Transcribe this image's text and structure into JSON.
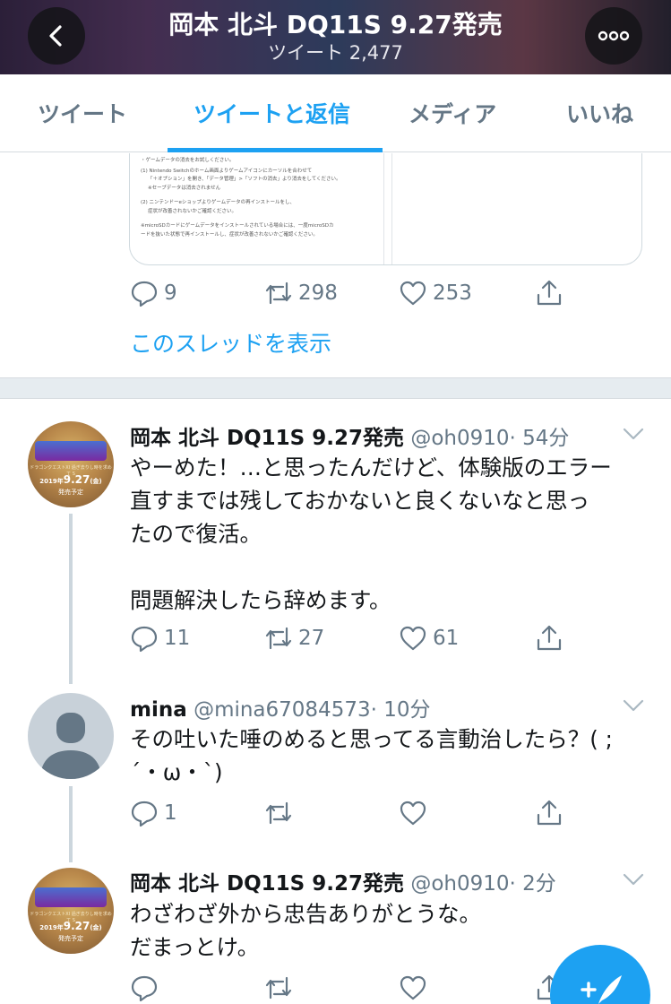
{
  "header": {
    "title": "岡本 北斗 DQ11S 9.27発売",
    "subtitle": "ツイート 2,477"
  },
  "tabs": [
    {
      "label": "ツイート",
      "active": false
    },
    {
      "label": "ツイートと返信",
      "active": true
    },
    {
      "label": "メディア",
      "active": false
    },
    {
      "label": "いいね",
      "active": false
    }
  ],
  "image_card": {
    "lines": [
      "・ゲームデータの消去をお試しください。",
      "(1) Nintendo Switchのホーム画面よりゲームアイコンにカーソルを合わせて",
      "「＋オプション」を開き、「データ管理」>「ソフトの消去」より消去をしてください。",
      "※セーブデータは消去されません",
      "(2) ニンテンドーeショップよりゲームデータの再インストールをし、",
      "症状が改善されないかご確認ください。",
      "※microSDカードにゲームデータをインストールされている場合には、一度microSDカ",
      "ードを抜いた状態で再インストールし、症状が改善されないかご確認ください。"
    ]
  },
  "first_actions": {
    "reply": "9",
    "retweet": "298",
    "like": "253"
  },
  "show_thread": "このスレッドを表示",
  "tweets": [
    {
      "name": "岡本 北斗 DQ11S 9.27発売",
      "handle": "@oh0910",
      "time": "· 54分",
      "text": "やーめた！…と思ったんだけど、体験版のエラー\n直すまでは残しておかないと良くないなと思っ\nたので復活。\n\n問題解決したら辞めます。",
      "reply": "11",
      "retweet": "27",
      "like": "61"
    },
    {
      "name": "mina",
      "handle": "@mina67084573",
      "time": "· 10分",
      "text": "その吐いた唾のめると思ってる言動治したら？( ;\n´・ω・`)",
      "reply": "1",
      "retweet": "",
      "like": ""
    },
    {
      "name": "岡本 北斗 DQ11S 9.27発売",
      "handle": "@oh0910",
      "time": "· 2分",
      "text": "わざわざ外から忠告ありがとうな。\nだまっとけ。",
      "reply": "",
      "retweet": "",
      "like": ""
    }
  ],
  "avatar_badge": {
    "top_text": "ドラゴンクエストXI 過ぎ去りし時を求めて S",
    "year": "2019年",
    "date": "9.27",
    "weekday": "(金)",
    "release": "発売予定"
  },
  "colors": {
    "accent": "#1da1f2",
    "muted": "#657786",
    "text": "#14171a"
  },
  "icons": {
    "back": "chevron-left-icon",
    "more": "more-icon",
    "reply": "reply-icon",
    "retweet": "retweet-icon",
    "like": "heart-icon",
    "share": "share-icon",
    "compose": "compose-icon"
  }
}
